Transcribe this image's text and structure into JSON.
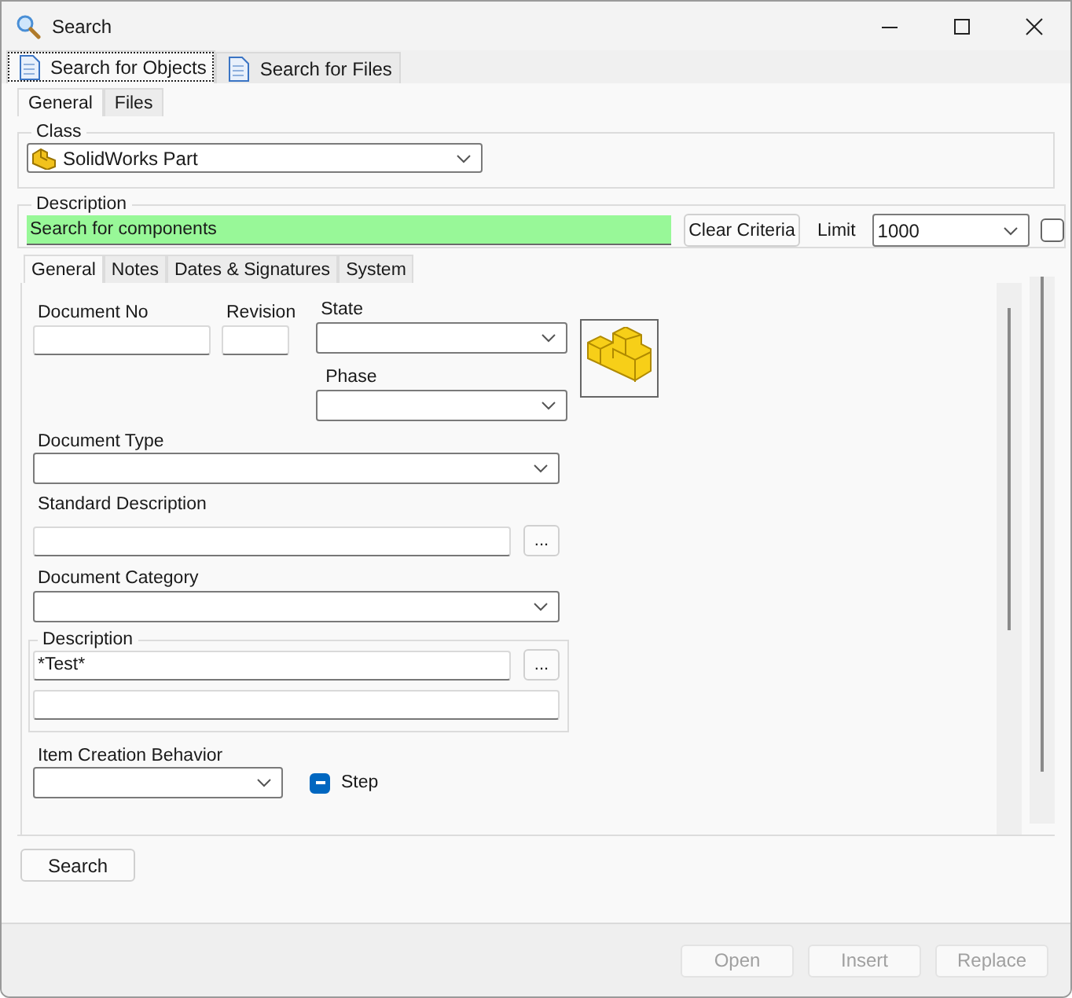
{
  "window": {
    "title": "Search"
  },
  "outer_tabs": [
    {
      "label": "Search for Objects",
      "selected": true
    },
    {
      "label": "Search for Files",
      "selected": false
    }
  ],
  "inner_tabs": [
    {
      "label": "General",
      "selected": true
    },
    {
      "label": "Files",
      "selected": false
    }
  ],
  "class_group": {
    "title": "Class",
    "value": "SolidWorks Part"
  },
  "description_group": {
    "title": "Description",
    "value": "Search for components",
    "clear_button": "Clear Criteria",
    "limit_label": "Limit",
    "limit_value": "1000",
    "checked": false
  },
  "detail_tabs": [
    {
      "label": "General",
      "selected": true
    },
    {
      "label": "Notes",
      "selected": false
    },
    {
      "label": "Dates & Signatures",
      "selected": false
    },
    {
      "label": "System",
      "selected": false
    }
  ],
  "fields": {
    "document_no": {
      "label": "Document No"
    },
    "revision": {
      "label": "Revision"
    },
    "state": {
      "label": "State"
    },
    "phase": {
      "label": "Phase"
    },
    "document_type": {
      "label": "Document Type"
    },
    "standard_description": {
      "label": "Standard Description",
      "browse": "..."
    },
    "document_category": {
      "label": "Document Category"
    },
    "description": {
      "title": "Description",
      "value": "*Test*",
      "browse": "..."
    },
    "item_creation_behavior": {
      "label": "Item Creation Behavior"
    },
    "step": {
      "label": "Step",
      "indeterminate": true
    }
  },
  "search_button": "Search",
  "footer_buttons": [
    {
      "label": "Open",
      "disabled": true
    },
    {
      "label": "Insert",
      "disabled": true
    },
    {
      "label": "Replace",
      "disabled": true
    }
  ]
}
